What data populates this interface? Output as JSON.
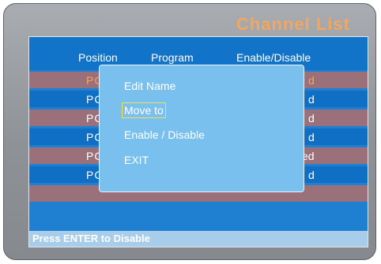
{
  "title": "Channel List",
  "columns": {
    "position": "Position",
    "program": "Program",
    "enable": "Enable/Disable"
  },
  "rows": [
    {
      "position": "PC",
      "enable": "d",
      "style": "p",
      "selected": true
    },
    {
      "position": "PC",
      "enable": "d",
      "style": "b",
      "selected": false
    },
    {
      "position": "PC",
      "enable": "d",
      "style": "p",
      "selected": false
    },
    {
      "position": "PC",
      "enable": "d",
      "style": "b",
      "selected": false
    },
    {
      "position": "PC",
      "enable": "ed",
      "style": "p",
      "selected": false
    },
    {
      "position": "PC",
      "enable": "d",
      "style": "b",
      "selected": false
    },
    {
      "position": "",
      "enable": "",
      "style": "p",
      "selected": false
    }
  ],
  "popup_menu": {
    "items": [
      {
        "label": "Edit Name"
      },
      {
        "label": "Move to",
        "highlighted": true
      },
      {
        "label": "Enable / Disable"
      },
      {
        "label": "EXIT"
      }
    ]
  },
  "status_bar": {
    "text": "Press ENTER to Disable"
  },
  "colors": {
    "accent_orange": "#f3a75e",
    "panel_blue": "#1f7fd0",
    "row_mauve": "#9a707b",
    "popup_blue": "#79c0ef",
    "highlight_yellow": "#f2e255"
  }
}
